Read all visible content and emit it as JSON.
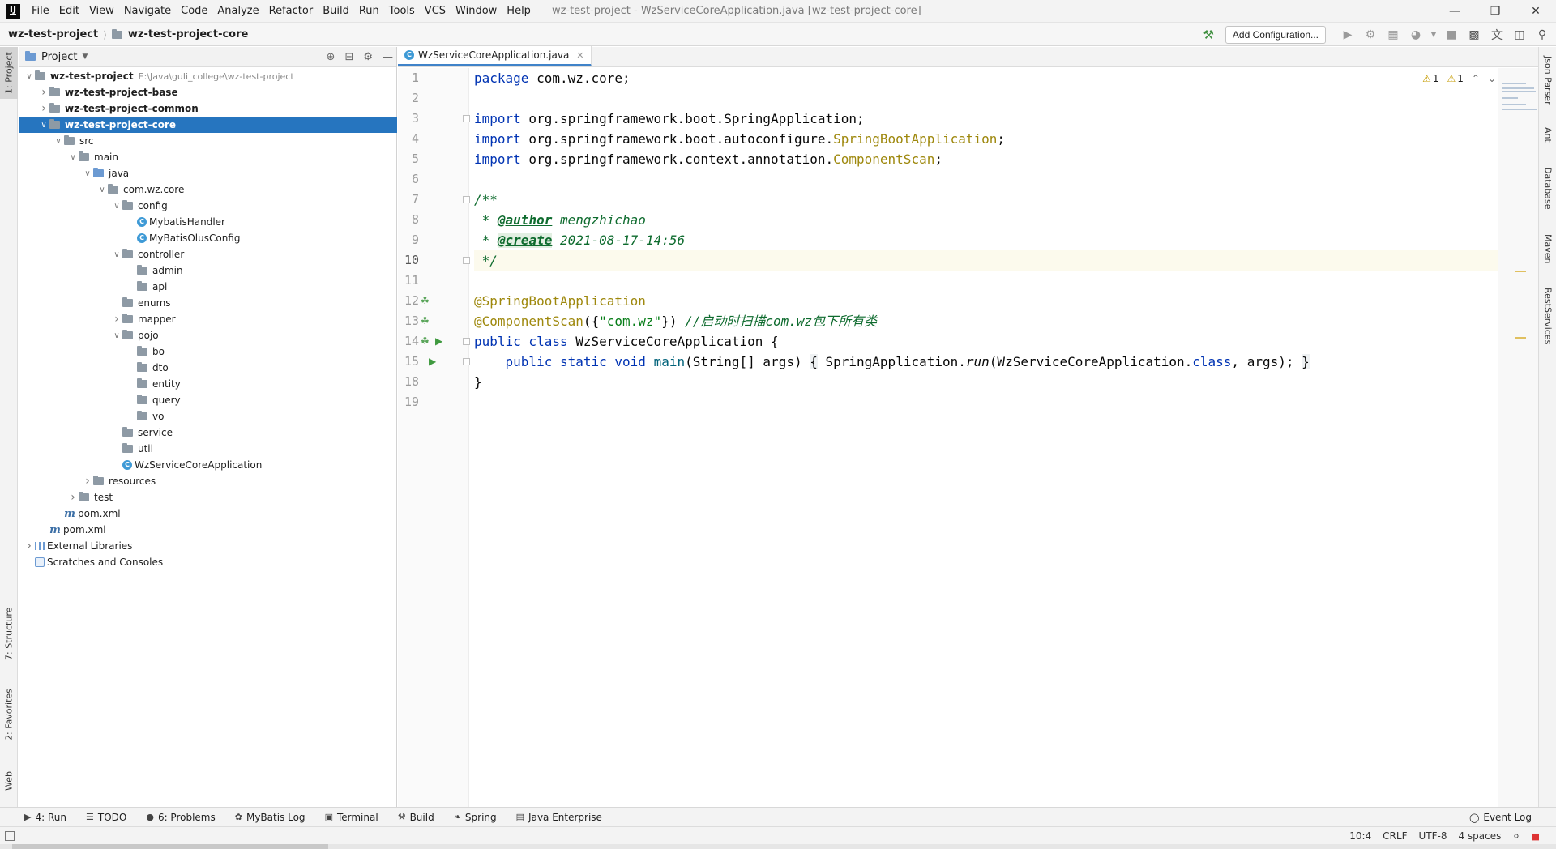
{
  "menu": {
    "items": [
      "File",
      "Edit",
      "View",
      "Navigate",
      "Code",
      "Analyze",
      "Refactor",
      "Build",
      "Run",
      "Tools",
      "VCS",
      "Window",
      "Help"
    ],
    "window_title": "wz-test-project - WzServiceCoreApplication.java [wz-test-project-core]",
    "logo_text": "IJ"
  },
  "navbar": {
    "crumbs": [
      "wz-test-project",
      "wz-test-project-core"
    ],
    "add_config_label": "Add Configuration..."
  },
  "left_stripe": {
    "tabs": [
      "1: Project",
      "7: Structure",
      "2: Favorites",
      "Web"
    ]
  },
  "right_stripe": {
    "tabs": [
      "Json Parser",
      "Ant",
      "Database",
      "Maven",
      "RestServices"
    ]
  },
  "project": {
    "title": "Project",
    "tree": [
      {
        "name": "wz-test-project",
        "path": "E:\\Java\\guli_college\\wz-test-project",
        "icon": "folder",
        "arrow": "open",
        "indent": 0,
        "bold": true
      },
      {
        "name": "wz-test-project-base",
        "icon": "folder",
        "arrow": "closed",
        "indent": 1,
        "bold": true
      },
      {
        "name": "wz-test-project-common",
        "icon": "folder",
        "arrow": "closed",
        "indent": 1,
        "bold": true
      },
      {
        "name": "wz-test-project-core",
        "icon": "folder",
        "arrow": "open",
        "indent": 1,
        "bold": true,
        "selected": true
      },
      {
        "name": "src",
        "icon": "folder",
        "arrow": "open",
        "indent": 2
      },
      {
        "name": "main",
        "icon": "folder",
        "arrow": "open",
        "indent": 3
      },
      {
        "name": "java",
        "icon": "folder-blue",
        "arrow": "open",
        "indent": 4
      },
      {
        "name": "com.wz.core",
        "icon": "folder",
        "arrow": "open",
        "indent": 5
      },
      {
        "name": "config",
        "icon": "folder",
        "arrow": "open",
        "indent": 6
      },
      {
        "name": "MybatisHandler",
        "icon": "class",
        "arrow": "none",
        "indent": 7
      },
      {
        "name": "MyBatisOlusConfig",
        "icon": "class",
        "arrow": "none",
        "indent": 7
      },
      {
        "name": "controller",
        "icon": "folder",
        "arrow": "open",
        "indent": 6
      },
      {
        "name": "admin",
        "icon": "folder",
        "arrow": "none",
        "indent": 7
      },
      {
        "name": "api",
        "icon": "folder",
        "arrow": "none",
        "indent": 7
      },
      {
        "name": "enums",
        "icon": "folder",
        "arrow": "none",
        "indent": 6
      },
      {
        "name": "mapper",
        "icon": "folder",
        "arrow": "closed",
        "indent": 6
      },
      {
        "name": "pojo",
        "icon": "folder",
        "arrow": "open",
        "indent": 6
      },
      {
        "name": "bo",
        "icon": "folder",
        "arrow": "none",
        "indent": 7
      },
      {
        "name": "dto",
        "icon": "folder",
        "arrow": "none",
        "indent": 7
      },
      {
        "name": "entity",
        "icon": "folder",
        "arrow": "none",
        "indent": 7
      },
      {
        "name": "query",
        "icon": "folder",
        "arrow": "none",
        "indent": 7
      },
      {
        "name": "vo",
        "icon": "folder",
        "arrow": "none",
        "indent": 7
      },
      {
        "name": "service",
        "icon": "folder",
        "arrow": "none",
        "indent": 6
      },
      {
        "name": "util",
        "icon": "folder",
        "arrow": "none",
        "indent": 6
      },
      {
        "name": "WzServiceCoreApplication",
        "icon": "class",
        "arrow": "none",
        "indent": 6
      },
      {
        "name": "resources",
        "icon": "folder",
        "arrow": "closed",
        "indent": 4
      },
      {
        "name": "test",
        "icon": "folder",
        "arrow": "closed",
        "indent": 3
      },
      {
        "name": "pom.xml",
        "icon": "maven",
        "arrow": "none",
        "indent": 2
      },
      {
        "name": "pom.xml",
        "icon": "maven",
        "arrow": "none",
        "indent": 1
      },
      {
        "name": "External Libraries",
        "icon": "library",
        "arrow": "closed",
        "indent": 0
      },
      {
        "name": "Scratches and Consoles",
        "icon": "scratch",
        "arrow": "none",
        "indent": 0
      }
    ]
  },
  "editor": {
    "tab_name": "WzServiceCoreApplication.java",
    "line_numbers": [
      "1",
      "2",
      "3",
      "4",
      "5",
      "6",
      "7",
      "8",
      "9",
      "10",
      "11",
      "12",
      "13",
      "14",
      "15",
      "18",
      "19"
    ],
    "current_line": "10",
    "inspection": {
      "warnings_a": "1",
      "warnings_b": "1"
    },
    "code": {
      "l1_kw": "package",
      "l1_rest": " com.wz.core;",
      "l3_kw": "import",
      "l3_rest": " org.springframework.boot.SpringApplication;",
      "l4_kw": "import",
      "l4_rest": " org.springframework.boot.autoconfigure.",
      "l4_ann": "SpringBootApplication",
      "l4_end": ";",
      "l5_kw": "import",
      "l5_rest": " org.springframework.context.annotation.",
      "l5_ann": "ComponentScan",
      "l5_end": ";",
      "l7": "/**",
      "l8_pre": " * ",
      "l8_tag": "@author",
      "l8_text": " mengzhichao",
      "l9_pre": " * ",
      "l9_tag": "@create",
      "l9_text": " 2021-08-17-14:56",
      "l10": " */",
      "l12_ann": "@SpringBootApplication",
      "l13_ann": "@ComponentScan",
      "l13_open": "({",
      "l13_str": "\"com.wz\"",
      "l13_close": "}) ",
      "l13_cmt": "//启动时扫描com.wz包下所有类",
      "l14_kw": "public class",
      "l14_rest": " WzServiceCoreApplication {",
      "l15_indent": "    ",
      "l15_kw": "public static void",
      "l15_sp": " ",
      "l15_fn": "main",
      "l15_args": "(String[] args) ",
      "l15_ob": "{",
      "l15_mid": " SpringApplication.",
      "l15_run": "run",
      "l15_call": "(WzServiceCoreApplication.",
      "l15_kw2": "class",
      "l15_end": ", args); ",
      "l15_cb": "}",
      "l18": "}"
    }
  },
  "bottom_tabs": [
    {
      "icon": "▶",
      "label": "4: Run"
    },
    {
      "icon": "☰",
      "label": "TODO"
    },
    {
      "icon": "●",
      "label": "6: Problems"
    },
    {
      "icon": "✿",
      "label": "MyBatis Log"
    },
    {
      "icon": "▣",
      "label": "Terminal"
    },
    {
      "icon": "⚒",
      "label": "Build"
    },
    {
      "icon": "❧",
      "label": "Spring"
    },
    {
      "icon": "▤",
      "label": "Java Enterprise"
    }
  ],
  "event_log_label": "Event Log",
  "status": {
    "position": "10:4",
    "line_sep": "CRLF",
    "encoding": "UTF-8",
    "indent": "4 spaces"
  },
  "colors": {
    "selection": "#2675bf",
    "keyword": "#0033b3",
    "annotation": "#9e880d",
    "comment": "#0e6b2e",
    "string": "#067d17"
  }
}
